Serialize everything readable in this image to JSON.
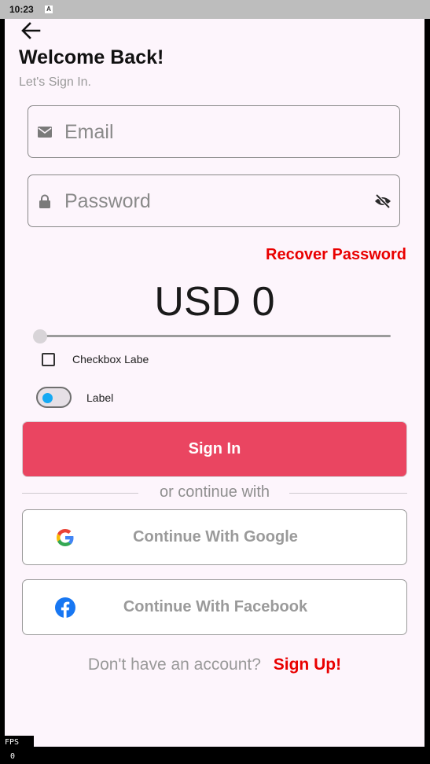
{
  "status_bar": {
    "time": "10:23",
    "notification_icon": "A"
  },
  "header": {
    "back_icon": "arrow-back-icon",
    "title": "Welcome Back!",
    "subtitle": "Let's Sign In."
  },
  "form": {
    "email": {
      "placeholder": "Email",
      "icon": "mail-icon"
    },
    "password": {
      "placeholder": "Password",
      "icon": "lock-icon",
      "toggle_icon": "eye-off-icon"
    },
    "recover_label": "Recover Password"
  },
  "amount": {
    "display": "USD 0",
    "slider_value": 0
  },
  "checkbox": {
    "label": "Checkbox Labe",
    "checked": false
  },
  "switch": {
    "label": "Label",
    "on": false
  },
  "sign_in_label": "Sign In",
  "divider_text": "or continue with",
  "social": {
    "google": {
      "label": "Continue With Google",
      "icon": "google-icon"
    },
    "facebook": {
      "label": "Continue With Facebook",
      "icon": "facebook-icon"
    }
  },
  "footer": {
    "question": "Don't have an account?",
    "signup_label": "Sign Up!"
  },
  "overlay": {
    "fps_label": "FPS",
    "fps_value": "0"
  },
  "colors": {
    "accent_red": "#e90000",
    "button_pink": "#ea4561",
    "background": "#fdf5fc",
    "switch_knob": "#16a9f3"
  }
}
